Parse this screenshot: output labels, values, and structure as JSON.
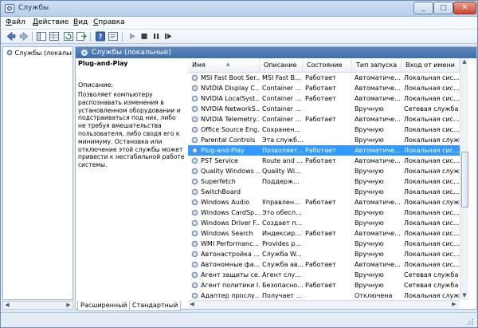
{
  "window": {
    "title": "Службы"
  },
  "menu": [
    {
      "label": "Файл",
      "hotkey": "Ф",
      "rest": "айл"
    },
    {
      "label": "Действие",
      "hotkey": "Д",
      "rest": "ействие"
    },
    {
      "label": "Вид",
      "hotkey": "В",
      "rest": "ид"
    },
    {
      "label": "Справка",
      "hotkey": "С",
      "rest": "правка"
    }
  ],
  "toolbar": {
    "icons": [
      "back-icon",
      "forward-icon",
      "tree-icon",
      "grid-icon",
      "refresh-icon",
      "export-icon",
      "help-icon",
      "console-icon",
      "play-icon",
      "stop-icon",
      "pause-icon",
      "restart-icon"
    ]
  },
  "left_pane": {
    "item": "Службы (локальные)"
  },
  "right_pane": {
    "header": "Службы (локальные)",
    "selected_name": "Plug-and-Play",
    "description_label": "Описание:",
    "description": "Позволяет компьютеру распознавать изменения в установленном оборудовании и подстраиваться под них, либо не требуя вмешательства пользователя, либо сводя его к минимуму. Остановка или отключение этой службы может привести к нестабильной работе системы."
  },
  "table": {
    "columns": [
      "Имя",
      "Описание",
      "Состояние",
      "Тип запуска",
      "Вход от имени"
    ],
    "rows": [
      [
        "MSI Fast Boot Ser...",
        "MSI Fast B...",
        "Работает",
        "Автоматиче...",
        "Локальная сис..."
      ],
      [
        "NVIDIA Display C...",
        "Container ...",
        "Работает",
        "Автоматиче...",
        "Локальная сис..."
      ],
      [
        "NVIDIA LocalSyst...",
        "Container ...",
        "Работает",
        "Автоматиче...",
        "Локальная сис..."
      ],
      [
        "NVIDIA NetworkS...",
        "Container ...",
        "",
        "Вручную",
        "Сетевая служба"
      ],
      [
        "NVIDIA Telemetry...",
        "Container ...",
        "Работает",
        "Автоматиче...",
        "Локальная сис..."
      ],
      [
        "Office Source Eng...",
        "Сохранен...",
        "",
        "Вручную",
        "Локальная сис..."
      ],
      [
        "Parental Controls",
        "Эта служб...",
        "",
        "Вручную",
        "Локальная служба"
      ],
      [
        "Plug-and-Play",
        "Позволяет...",
        "Работает",
        "Автоматиче...",
        "Локальная сис..."
      ],
      [
        "PST Service",
        "Route and ...",
        "Работает",
        "Автоматиче...",
        "Локальная сис..."
      ],
      [
        "Quality Windows ...",
        "Quality Wi...",
        "",
        "Вручную",
        "Локальная служба"
      ],
      [
        "Superfetch",
        "Поддерж...",
        "",
        "Вручную",
        "Локальная сис..."
      ],
      [
        "SwitchBoard",
        "",
        "",
        "Вручную",
        "Локальная сис..."
      ],
      [
        "Windows Audio",
        "Управлен...",
        "Работает",
        "Автоматиче...",
        "Локальная служба"
      ],
      [
        "Windows CardSp...",
        "Это обесп...",
        "",
        "Вручную",
        "Локальная сис..."
      ],
      [
        "Windows Driver F...",
        "Создает п...",
        "",
        "Вручную",
        "Локальная сис..."
      ],
      [
        "Windows Search",
        "Индексир...",
        "Работает",
        "Автоматиче...",
        "Локальная сис..."
      ],
      [
        "WMI Performanc...",
        "Provides p...",
        "",
        "Вручную",
        "Локальная сис..."
      ],
      [
        "Автонастройка ...",
        "Служба W...",
        "",
        "Вручную",
        "Локальная сис..."
      ],
      [
        "Автономные фа...",
        "Служба ав...",
        "Работает",
        "Автоматиче...",
        "Локальная сис..."
      ],
      [
        "Агент защиты се...",
        "Агент слу...",
        "",
        "Вручную",
        "Сетевая служба"
      ],
      [
        "Агент политики I...",
        "Безопасно...",
        "Работает",
        "Вручную",
        "Сетевая служба"
      ],
      [
        "Адаптер прослу...",
        "Получает ...",
        "",
        "Отключена",
        "Локальная служба"
      ]
    ],
    "selected_row": 7
  },
  "tabs": [
    "Расширенный",
    "Стандартный"
  ],
  "colors": {
    "selection": "#3399ff",
    "header_blue": "#4f7db7",
    "frame": "#6b8db3"
  }
}
